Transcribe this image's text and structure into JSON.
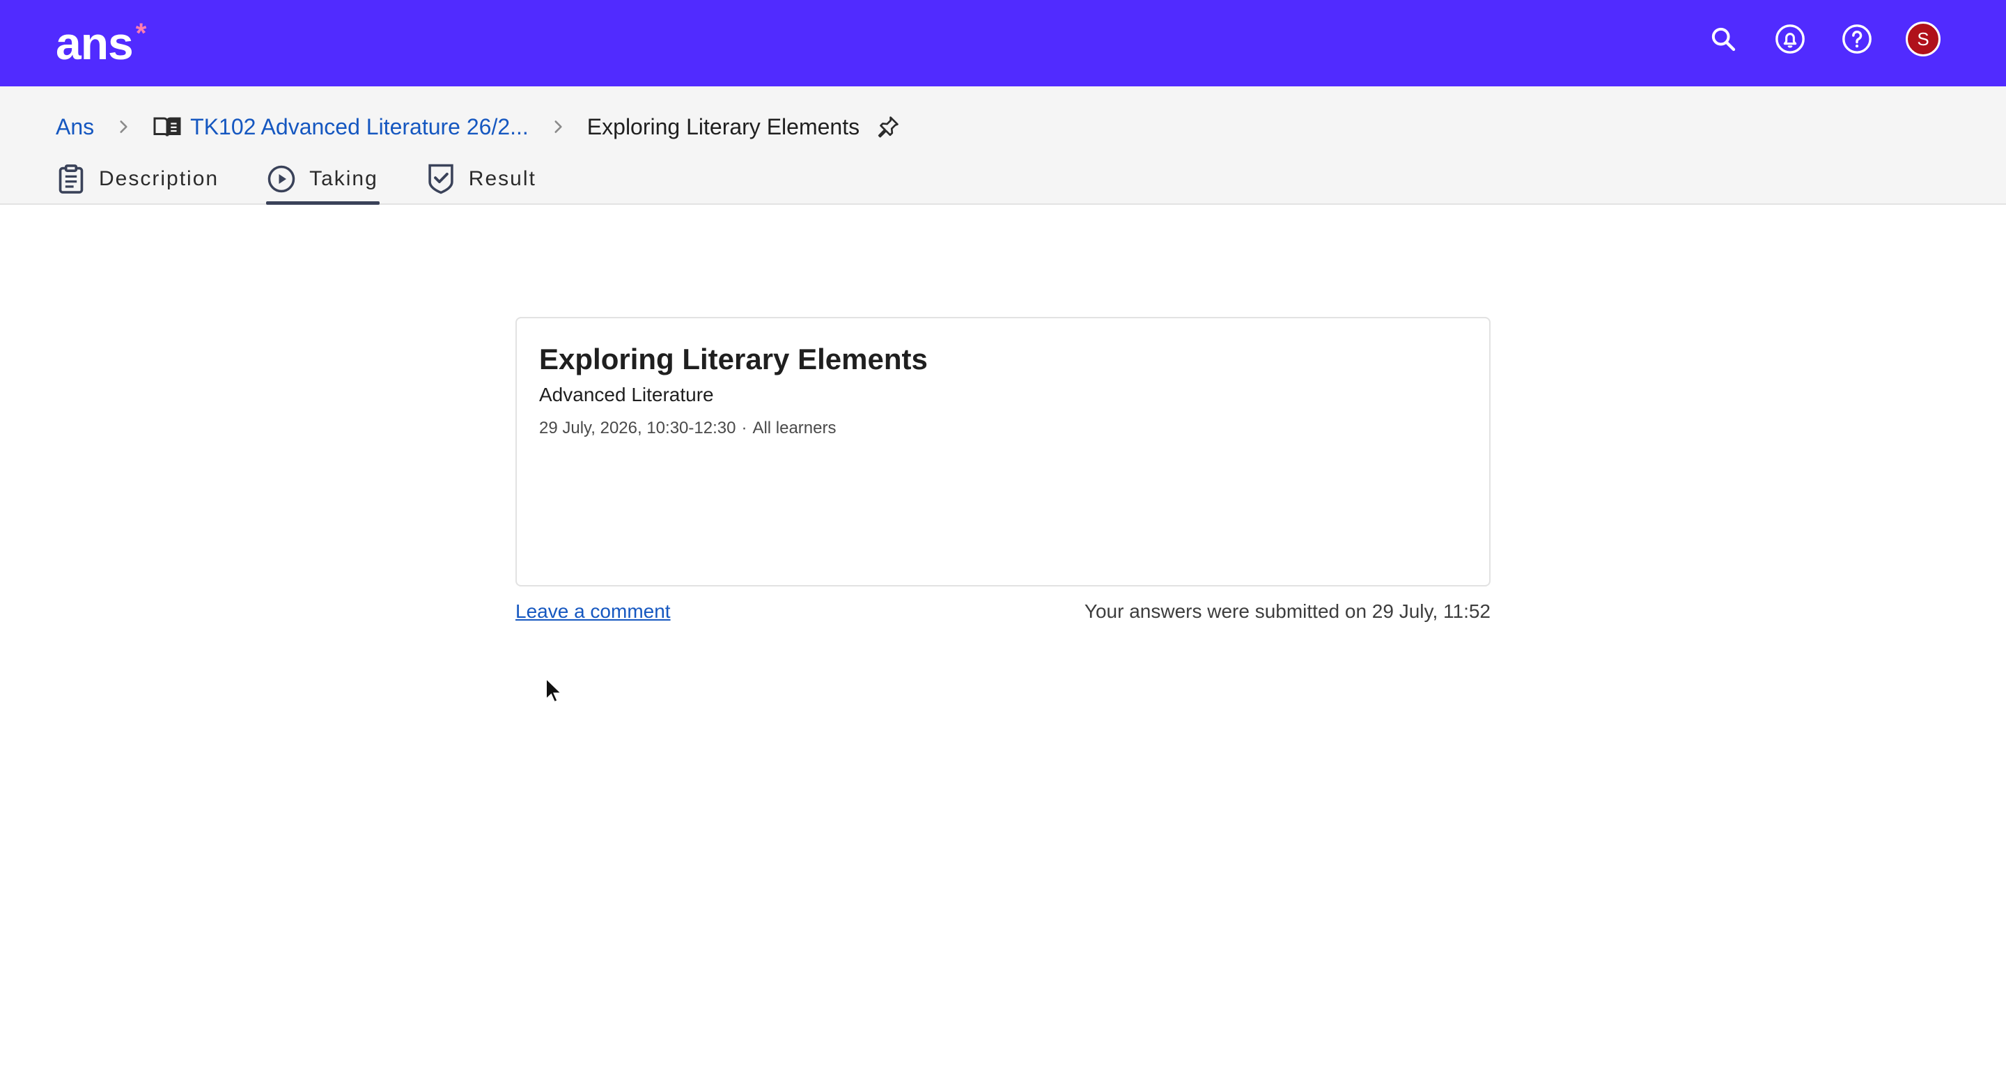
{
  "topbar": {
    "logo_text": "ans",
    "logo_mark": "*",
    "brand_color": "#512bff",
    "icons": [
      "search-icon",
      "notifications-icon",
      "help-icon"
    ],
    "avatar_initial": "S"
  },
  "breadcrumb": {
    "root": "Ans",
    "course": "TK102 Advanced Literature 26/2...",
    "current": "Exploring Literary Elements"
  },
  "tabs": [
    {
      "label": "Description",
      "icon": "clipboard-icon",
      "active": false
    },
    {
      "label": "Taking",
      "icon": "play-circle-icon",
      "active": true
    },
    {
      "label": "Result",
      "icon": "shield-check-icon",
      "active": false
    }
  ],
  "card": {
    "title": "Exploring Literary Elements",
    "subtitle": "Advanced Literature",
    "date": "29 July, 2026, 10:30-12:30",
    "separator": "·",
    "audience": "All learners"
  },
  "footer": {
    "comment_link": "Leave a comment",
    "submitted_text": "Your answers were submitted on 29 July, 11:52"
  }
}
